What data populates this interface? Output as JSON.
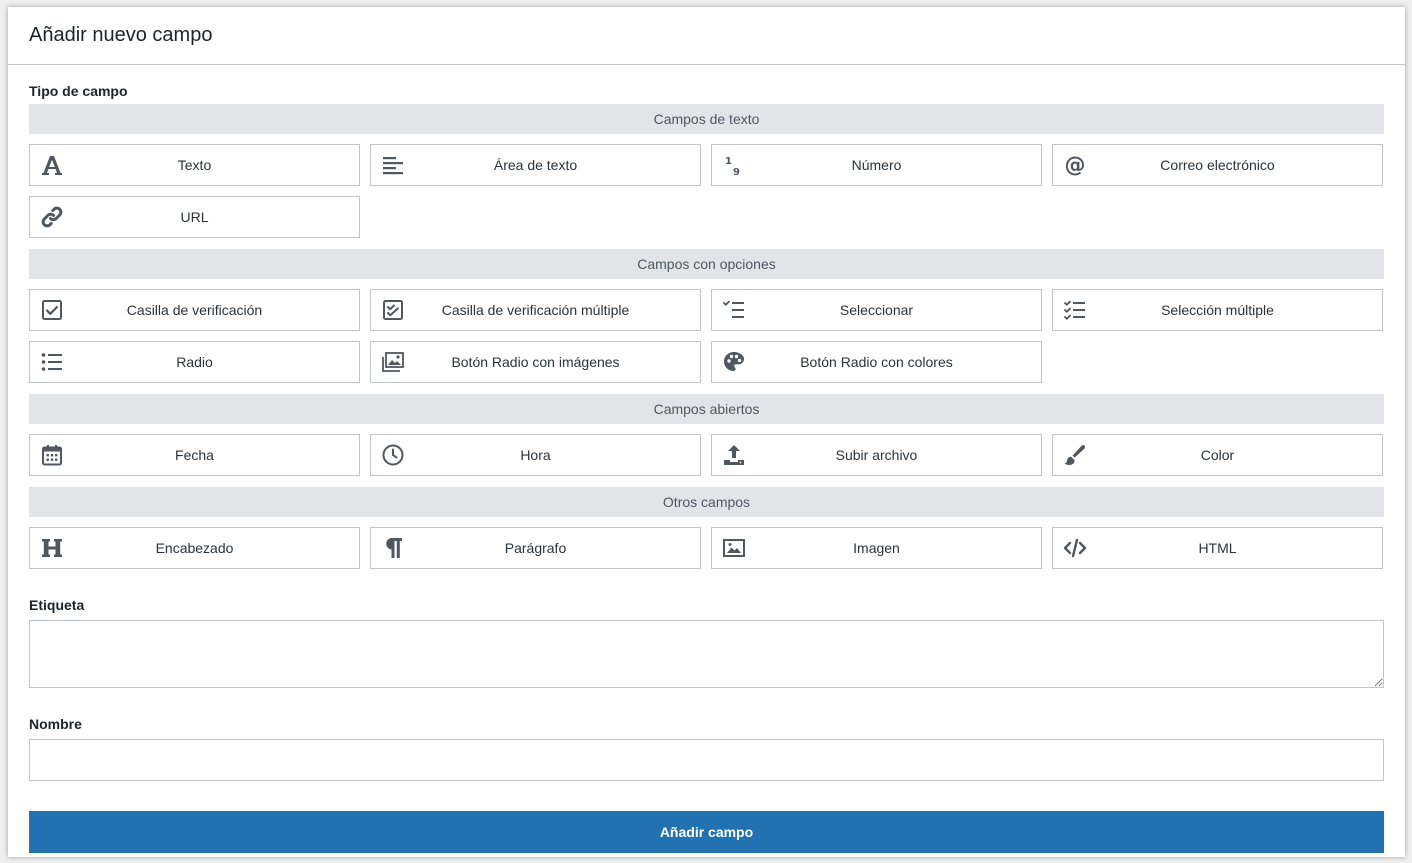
{
  "panel": {
    "title": "Añadir nuevo campo"
  },
  "field_type": {
    "label": "Tipo de campo",
    "sections": [
      {
        "title": "Campos de texto",
        "items": [
          {
            "label": "Texto",
            "icon": "text-letter-icon"
          },
          {
            "label": "Área de texto",
            "icon": "textarea-lines-icon"
          },
          {
            "label": "Número",
            "icon": "number-icon"
          },
          {
            "label": "Correo electrónico",
            "icon": "at-sign-icon"
          },
          {
            "label": "URL",
            "icon": "link-icon"
          }
        ]
      },
      {
        "title": "Campos con opciones",
        "items": [
          {
            "label": "Casilla de verificación",
            "icon": "checkbox-icon"
          },
          {
            "label": "Casilla de verificación múltiple",
            "icon": "checkbox-multiple-icon"
          },
          {
            "label": "Seleccionar",
            "icon": "select-list-icon"
          },
          {
            "label": "Selección múltiple",
            "icon": "multi-select-list-icon"
          },
          {
            "label": "Radio",
            "icon": "radio-list-icon"
          },
          {
            "label": "Botón Radio con imágenes",
            "icon": "images-icon"
          },
          {
            "label": "Botón Radio con colores",
            "icon": "palette-icon"
          }
        ]
      },
      {
        "title": "Campos abiertos",
        "items": [
          {
            "label": "Fecha",
            "icon": "calendar-icon"
          },
          {
            "label": "Hora",
            "icon": "clock-icon"
          },
          {
            "label": "Subir archivo",
            "icon": "upload-icon"
          },
          {
            "label": "Color",
            "icon": "paintbrush-icon"
          }
        ]
      },
      {
        "title": "Otros campos",
        "items": [
          {
            "label": "Encabezado",
            "icon": "heading-icon"
          },
          {
            "label": "Parágrafo",
            "icon": "paragraph-icon"
          },
          {
            "label": "Imagen",
            "icon": "image-icon"
          },
          {
            "label": "HTML",
            "icon": "code-icon"
          }
        ]
      }
    ]
  },
  "label_field": {
    "label": "Etiqueta",
    "value": ""
  },
  "name_field": {
    "label": "Nombre",
    "value": ""
  },
  "submit": {
    "label": "Añadir campo",
    "color": "#2271b1"
  },
  "colors": {
    "icon": "#50575e",
    "section_bg": "#e3e4e8",
    "border": "#c3c4c7"
  }
}
